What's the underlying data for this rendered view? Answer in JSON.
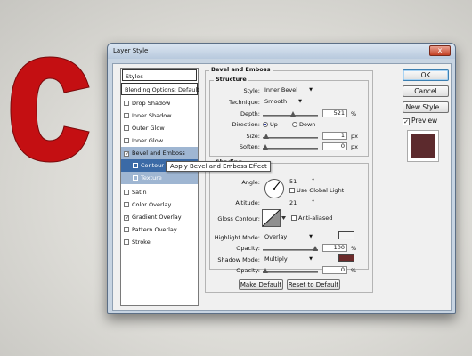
{
  "window": {
    "title": "Layer Style",
    "close_glyph": "x"
  },
  "styles_panel": {
    "header": "Styles",
    "items": [
      {
        "label": "Blending Options: Default",
        "checkbox": false,
        "checked": false
      },
      {
        "label": "Drop Shadow",
        "checkbox": true,
        "checked": false
      },
      {
        "label": "Inner Shadow",
        "checkbox": true,
        "checked": false
      },
      {
        "label": "Outer Glow",
        "checkbox": true,
        "checked": false
      },
      {
        "label": "Inner Glow",
        "checkbox": true,
        "checked": false
      },
      {
        "label": "Bevel and Emboss",
        "checkbox": true,
        "checked": true,
        "selected": true
      },
      {
        "label": "Contour",
        "sub": true,
        "highlighted": true
      },
      {
        "label": "Texture",
        "sub": true
      },
      {
        "label": "Satin",
        "checkbox": true,
        "checked": false
      },
      {
        "label": "Color Overlay",
        "checkbox": true,
        "checked": false
      },
      {
        "label": "Gradient Overlay",
        "checkbox": true,
        "checked": true
      },
      {
        "label": "Pattern Overlay",
        "checkbox": true,
        "checked": false
      },
      {
        "label": "Stroke",
        "checkbox": true,
        "checked": false
      }
    ]
  },
  "tooltip": "Apply Bevel and Emboss Effect",
  "bevel": {
    "group_title": "Bevel and Emboss",
    "structure_title": "Structure",
    "style_label": "Style:",
    "style_value": "Inner Bevel",
    "technique_label": "Technique:",
    "technique_value": "Smooth",
    "depth_label": "Depth:",
    "depth_value": "521",
    "depth_unit": "%",
    "direction_label": "Direction:",
    "dir_up": "Up",
    "dir_down": "Down",
    "size_label": "Size:",
    "size_value": "1",
    "size_unit": "px",
    "soften_label": "Soften:",
    "soften_value": "0",
    "soften_unit": "px",
    "shading_title": "Shading",
    "angle_label": "Angle:",
    "angle_value": "51",
    "angle_unit": "°",
    "global_light_label": "Use Global Light",
    "altitude_label": "Altitude:",
    "altitude_value": "21",
    "altitude_unit": "°",
    "gloss_label": "Gloss Contour:",
    "antialiased_label": "Anti-aliased",
    "highlight_label": "Highlight Mode:",
    "highlight_value": "Overlay",
    "highlight_opacity_label": "Opacity:",
    "highlight_opacity_value": "100",
    "highlight_opacity_unit": "%",
    "shadow_label": "Shadow Mode:",
    "shadow_value": "Multiply",
    "shadow_opacity_label": "Opacity:",
    "shadow_opacity_value": "0",
    "shadow_opacity_unit": "%",
    "make_default": "Make Default",
    "reset_default": "Reset to Default"
  },
  "sliders": {
    "depth": 0.55,
    "size": 0.02,
    "soften": 0.0,
    "highlight_opacity": 1.0,
    "shadow_opacity": 0.0
  },
  "buttons": {
    "ok": "OK",
    "cancel": "Cancel",
    "new_style": "New Style...",
    "preview": "Preview"
  },
  "preview_checked": true,
  "colors": {
    "canvas_letter": "#c40f12",
    "highlight_color": "#f3f3f3",
    "shadow_color": "#6b2a2a",
    "preview_swatch": "#5c2a2d"
  },
  "icons": [
    "close-icon",
    "chevron-down-icon",
    "angle-dial-icon",
    "contour-icon",
    "checkbox-icon",
    "radio-icon"
  ]
}
